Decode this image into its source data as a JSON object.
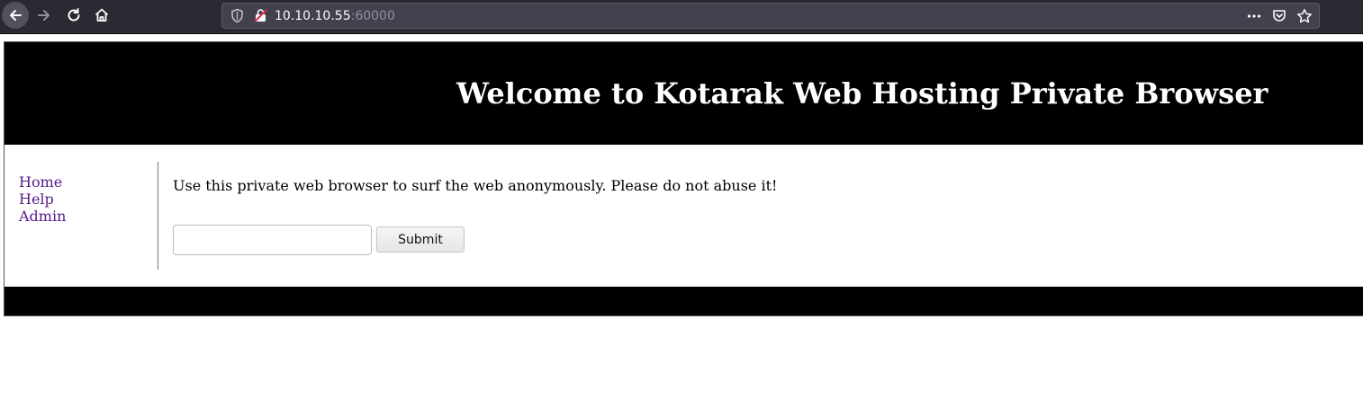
{
  "browser": {
    "url_host": "10.10.10.55",
    "url_port": ":60000",
    "icons": {
      "back": "arrow-left-icon",
      "forward": "arrow-right-icon",
      "reload": "reload-icon",
      "home": "home-icon",
      "tracking": "shield-icon",
      "insecure": "insecure-lock-icon",
      "more": "more-dots-icon",
      "pocket": "pocket-icon",
      "bookmark": "star-icon"
    }
  },
  "page": {
    "header_title": "Welcome to Kotarak Web Hosting Private Browser",
    "sidebar_links": [
      "Home",
      "Help",
      "Admin"
    ],
    "intro_text": "Use this private web browser to surf the web anonymously. Please do not abuse it!",
    "url_input_value": "",
    "submit_label": "Submit",
    "colors": {
      "header_bg": "#000000",
      "link": "#551a8b",
      "chrome_bg": "#2b2a33"
    }
  }
}
